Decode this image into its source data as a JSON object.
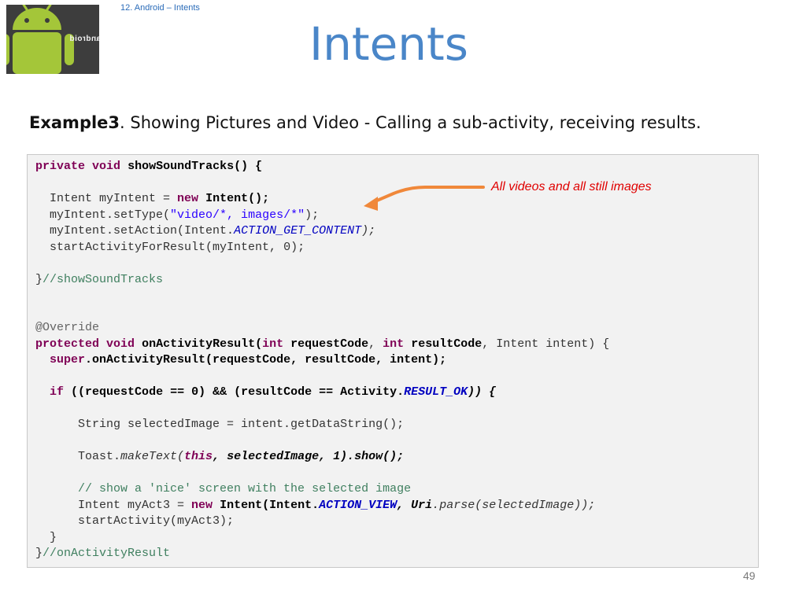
{
  "header": {
    "breadcrumb": "12. Android – Intents",
    "title": "Intents",
    "logo_text": "android"
  },
  "subtitle": {
    "bold": "Example3",
    "text": ".  Showing Pictures and Video - Calling a sub-activity, receiving results."
  },
  "annotation": {
    "text": "All videos and all still images",
    "color": "#e00000",
    "arrow_color": "#f0883a"
  },
  "code": {
    "l1_kw1": "private",
    "l1_kw2": "void",
    "l1_sig": "showSoundTracks() {",
    "l3_a": "Intent myIntent = ",
    "l3_kw": "new",
    "l3_b": "Intent();",
    "l4_a": "myIntent.setType(",
    "l4_str": "\"video/*, images/*\"",
    "l4_b": ");",
    "l5_a": "myIntent.setAction(Intent.",
    "l5_const": "ACTION_GET_CONTENT",
    "l5_b": ");",
    "l6": "startActivityForResult(myIntent, 0);",
    "l8_brace": "}",
    "l8_cmt": "//showSoundTracks",
    "l11_ann": "@Override",
    "l12_kw1": "protected",
    "l12_kw2": "void",
    "l12_a": "onActivityResult(",
    "l12_kw3": "int",
    "l12_b": "requestCode",
    "l12_c": ", ",
    "l12_kw4": "int",
    "l12_d": "resultCode",
    "l12_e": ", Intent intent) {",
    "l13_kw": "super",
    "l13_a": ".onActivityResult(requestCode, resultCode, intent);",
    "l15_kw": "if",
    "l15_a": "((requestCode == 0) && (resultCode == Activity.",
    "l15_const": "RESULT_OK",
    "l15_b": ")) {",
    "l17": "String selectedImage = intent.getDataString();",
    "l19_a": "Toast.",
    "l19_it": "makeText(",
    "l19_kw": "this",
    "l19_b": ", selectedImage, 1).show();",
    "l21_cmt": "// show a 'nice' screen with the selected image",
    "l22_a": "Intent myAct3 = ",
    "l22_kw": "new",
    "l22_b": "Intent(Intent.",
    "l22_const": "ACTION_VIEW",
    "l22_c": ", ",
    "l22_d": "Uri",
    "l22_e": ".",
    "l22_f": "parse(selectedImage));",
    "l23": "startActivity(myAct3);",
    "l24": "}",
    "l25_brace": "}",
    "l25_cmt": "//onActivityResult"
  },
  "footer": {
    "page_number": "49"
  }
}
